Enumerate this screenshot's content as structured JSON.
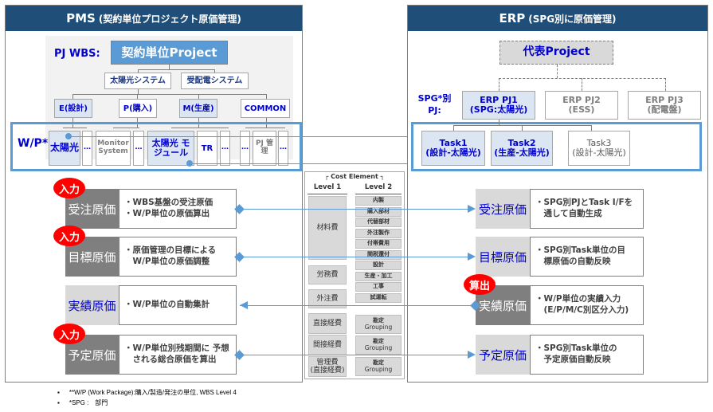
{
  "pms": {
    "title": "PMS",
    "subtitle": "(契約単位プロジェクト原価管理)",
    "wbs_label": "PJ WBS:",
    "project": "契約単位Project",
    "systems": [
      "太陽光システム",
      "受配電システム"
    ],
    "categories": [
      "E(設計)",
      "P(購入)",
      "M(生産)",
      "COMMON"
    ],
    "wp_label": "W/P*",
    "wp_items": [
      {
        "text": "太陽光",
        "highlight": true
      },
      {
        "text": "…",
        "highlight": false
      },
      {
        "text": "Monitor System",
        "highlight": false
      },
      {
        "text": "…",
        "highlight": false
      },
      {
        "text": "太陽光 モジュール",
        "highlight": true
      },
      {
        "text": "TR",
        "highlight": false
      },
      {
        "text": "…",
        "highlight": false
      },
      {
        "text": "…",
        "highlight": false
      },
      {
        "text": "PJ 管理",
        "highlight": false
      },
      {
        "text": "…",
        "highlight": false
      }
    ],
    "costs": [
      {
        "badge": "入力",
        "label": "受注原価",
        "style": "dark",
        "lines": [
          "・WBS基盤の受注原価",
          "・W/P単位の原価算出"
        ]
      },
      {
        "badge": "入力",
        "label": "目標原価",
        "style": "dark",
        "lines": [
          "・原価管理の目標による",
          "　W/P単位の原価調整"
        ]
      },
      {
        "badge": "",
        "label": "実績原価",
        "style": "light",
        "lines": [
          "・W/P単位の自動集計"
        ]
      },
      {
        "badge": "入力",
        "label": "予定原価",
        "style": "dark",
        "lines": [
          "・W/P単位別残期間に 予想",
          "　される総合原価を算出"
        ]
      }
    ]
  },
  "erp": {
    "title": "ERP",
    "subtitle": "(SPG別に原価管理)",
    "rep_project": "代表Project",
    "spg_label_1": "SPG*別",
    "spg_label_2": "PJ:",
    "pjs": [
      {
        "line1": "ERP PJ1",
        "line2": "(SPG:太陽光)",
        "highlight": true
      },
      {
        "line1": "ERP PJ2",
        "line2": "(ESS)",
        "highlight": false
      },
      {
        "line1": "ERP PJ3",
        "line2": "(配電盤)",
        "highlight": false
      }
    ],
    "tasks": [
      {
        "line1": "Task1",
        "line2": "(設計-太陽光)",
        "highlight": true
      },
      {
        "line1": "Task2",
        "line2": "(生産-太陽光)",
        "highlight": true
      },
      {
        "line1": "Task3",
        "line2": "(設計-太陽光)",
        "highlight": false
      }
    ],
    "costs": [
      {
        "badge": "",
        "label": "受注原価",
        "style": "light",
        "lines": [
          "・SPG別PJとTask I/Fを",
          "　通して自動生成"
        ]
      },
      {
        "badge": "",
        "label": "目標原価",
        "style": "light",
        "lines": [
          "・SPG別Task単位の目",
          "　標原価の自動反映"
        ]
      },
      {
        "badge": "算出",
        "label": "実績原価",
        "style": "dark",
        "lines": [
          "・W/P単位の実績入力",
          "　(E/P/M/C別区分入力)"
        ]
      },
      {
        "badge": "",
        "label": "予定原価",
        "style": "light",
        "lines": [
          "・SPG別Task単位の",
          "　予定原価自動反映"
        ]
      }
    ]
  },
  "cost_element": {
    "title": "Cost Element",
    "level1_header": "Level 1",
    "level2_header": "Level 2",
    "level1": [
      "材料費",
      "労務費",
      "外注費",
      "直接経費",
      "間接経費",
      "管理費\n(直接経費)"
    ],
    "level2": [
      "内製",
      "購入部材",
      "代替部材",
      "外注製作",
      "付帯費用",
      "関税還付",
      "設計",
      "生産・加工",
      "工事",
      "試運転"
    ],
    "grouping_line1": "勘定",
    "grouping_line2": "Grouping"
  },
  "footnotes": [
    "**W/P (Work Package):購入/製造/発注の単位, WBS Level 4",
    "*SPG :　部門"
  ]
}
